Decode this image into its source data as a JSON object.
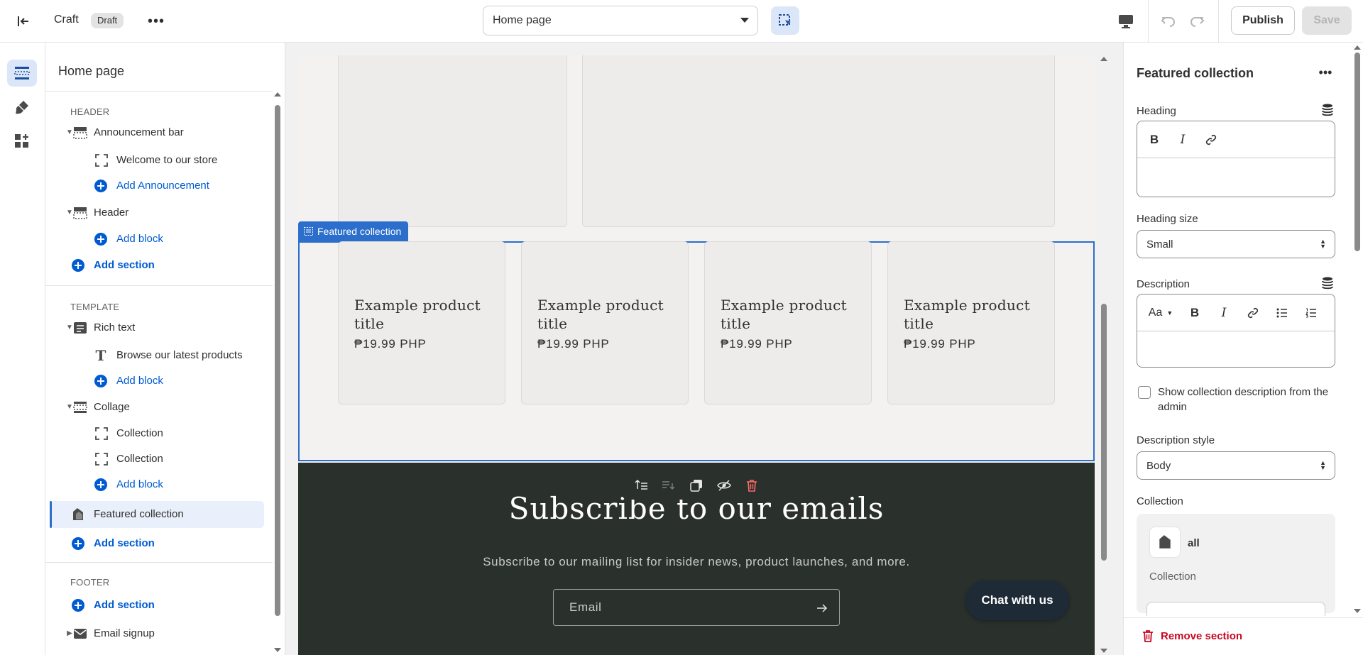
{
  "topbar": {
    "store_name": "Craft",
    "status_badge": "Draft",
    "template_select": "Home page",
    "publish_label": "Publish",
    "save_label": "Save"
  },
  "sidebar": {
    "title": "Home page",
    "groups": {
      "header": {
        "title": "HEADER",
        "items": {
          "announcement_bar": "Announcement bar",
          "welcome": "Welcome to our store",
          "add_announcement": "Add Announcement",
          "header": "Header",
          "add_block": "Add block",
          "add_section": "Add section"
        }
      },
      "template": {
        "title": "TEMPLATE",
        "items": {
          "rich_text": "Rich text",
          "browse": "Browse our latest products",
          "add_block_1": "Add block",
          "collage": "Collage",
          "collection_1": "Collection",
          "collection_2": "Collection",
          "add_block_2": "Add block",
          "featured_collection": "Featured collection",
          "add_section": "Add section"
        }
      },
      "footer": {
        "title": "FOOTER",
        "items": {
          "add_section": "Add section",
          "email_signup": "Email signup"
        }
      }
    }
  },
  "preview": {
    "selected_tag": "Featured collection",
    "products": [
      {
        "title": "Example product title",
        "price": "₱19.99 PHP"
      },
      {
        "title": "Example product title",
        "price": "₱19.99 PHP"
      },
      {
        "title": "Example product title",
        "price": "₱19.99 PHP"
      },
      {
        "title": "Example product title",
        "price": "₱19.99 PHP"
      }
    ],
    "newsletter": {
      "heading": "Subscribe to our emails",
      "subtext": "Subscribe to our mailing list for insider news, product launches, and more.",
      "email_placeholder": "Email"
    },
    "chat_label": "Chat with us"
  },
  "settings": {
    "title": "Featured collection",
    "heading_label": "Heading",
    "heading_size_label": "Heading size",
    "heading_size_value": "Small",
    "description_label": "Description",
    "description_font_btn": "Aa",
    "show_desc_label": "Show collection description from the admin",
    "description_style_label": "Description style",
    "description_style_value": "Body",
    "collection_label": "Collection",
    "collection_name": "all",
    "collection_type": "Collection",
    "remove_label": "Remove section"
  },
  "colors": {
    "accent": "#005bd3",
    "selection": "#2c6ecb",
    "newsletter_bg": "#2a302c",
    "danger": "#c70a24"
  }
}
